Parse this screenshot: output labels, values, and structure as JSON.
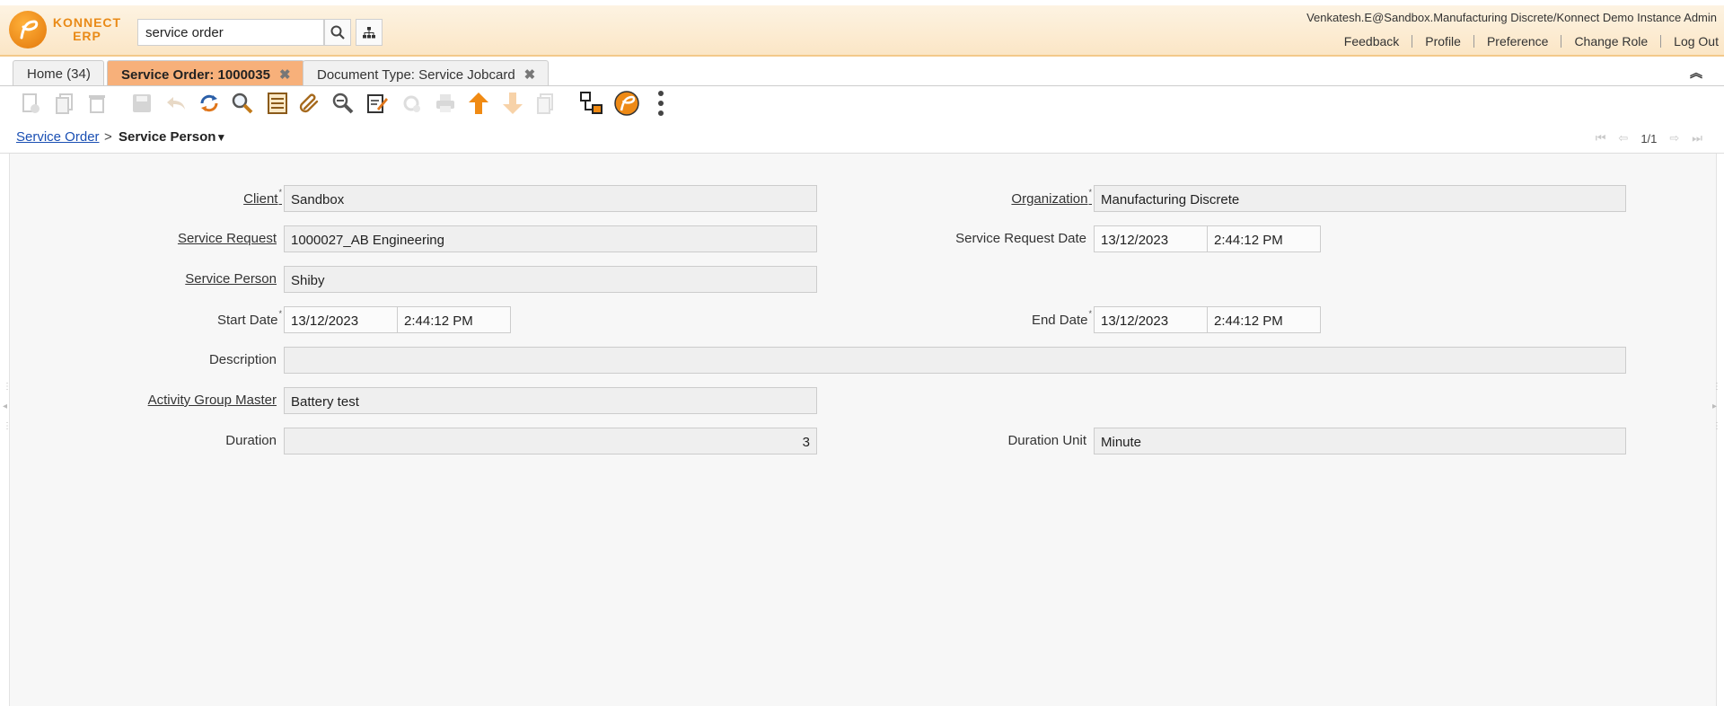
{
  "app": {
    "logo_text_line1": "KONNECT",
    "logo_text_line2": "ERP",
    "search_value": "service order",
    "user": "Venkatesh.E@Sandbox.Manufacturing Discrete/Konnect Demo Instance Admin",
    "links": [
      "Feedback",
      "Profile",
      "Preference",
      "Change Role",
      "Log Out"
    ]
  },
  "tabs": [
    {
      "label": "Home (34)",
      "active": false,
      "closable": false
    },
    {
      "label": "Service Order: 1000035",
      "active": true,
      "closable": true
    },
    {
      "label": "Document Type: Service Jobcard",
      "active": false,
      "closable": true
    }
  ],
  "toolbar": {
    "icons": [
      "new-icon",
      "copy-icon",
      "delete-icon",
      "save-icon",
      "undo-icon",
      "refresh-icon",
      "find-icon",
      "grid-toggle-icon",
      "attachment-icon",
      "zoom-across-icon",
      "chat-icon",
      "workflow-icon",
      "print-icon",
      "parent-record-icon",
      "detail-record-icon",
      "report-icon",
      "process-icon",
      "logo-menu-icon",
      "more-icon"
    ]
  },
  "breadcrumb": {
    "parent": "Service Order",
    "separator": ">",
    "current": "Service Person",
    "record_count": "1/1"
  },
  "form": {
    "client_label": "Client",
    "client_value": "Sandbox",
    "organization_label": "Organization",
    "organization_value": "Manufacturing Discrete",
    "service_request_label": "Service Request",
    "service_request_value": "1000027_AB Engineering",
    "service_request_date_label": "Service Request Date",
    "service_request_date": "13/12/2023",
    "service_request_time": "2:44:12 PM",
    "service_person_label": "Service Person",
    "service_person_value": "Shiby",
    "start_date_label": "Start Date",
    "start_date": "13/12/2023",
    "start_time": "2:44:12 PM",
    "end_date_label": "End Date",
    "end_date": "13/12/2023",
    "end_time": "2:44:12 PM",
    "description_label": "Description",
    "description_value": "",
    "activity_group_label": "Activity Group Master",
    "activity_group_value": "Battery test",
    "duration_label": "Duration",
    "duration_value": "3",
    "duration_unit_label": "Duration Unit",
    "duration_unit_value": "Minute",
    "required_mark": "*"
  },
  "colors": {
    "active_tab": "#f7b07a",
    "brand_orange": "#e98a17",
    "link_blue": "#1a4fb3"
  }
}
